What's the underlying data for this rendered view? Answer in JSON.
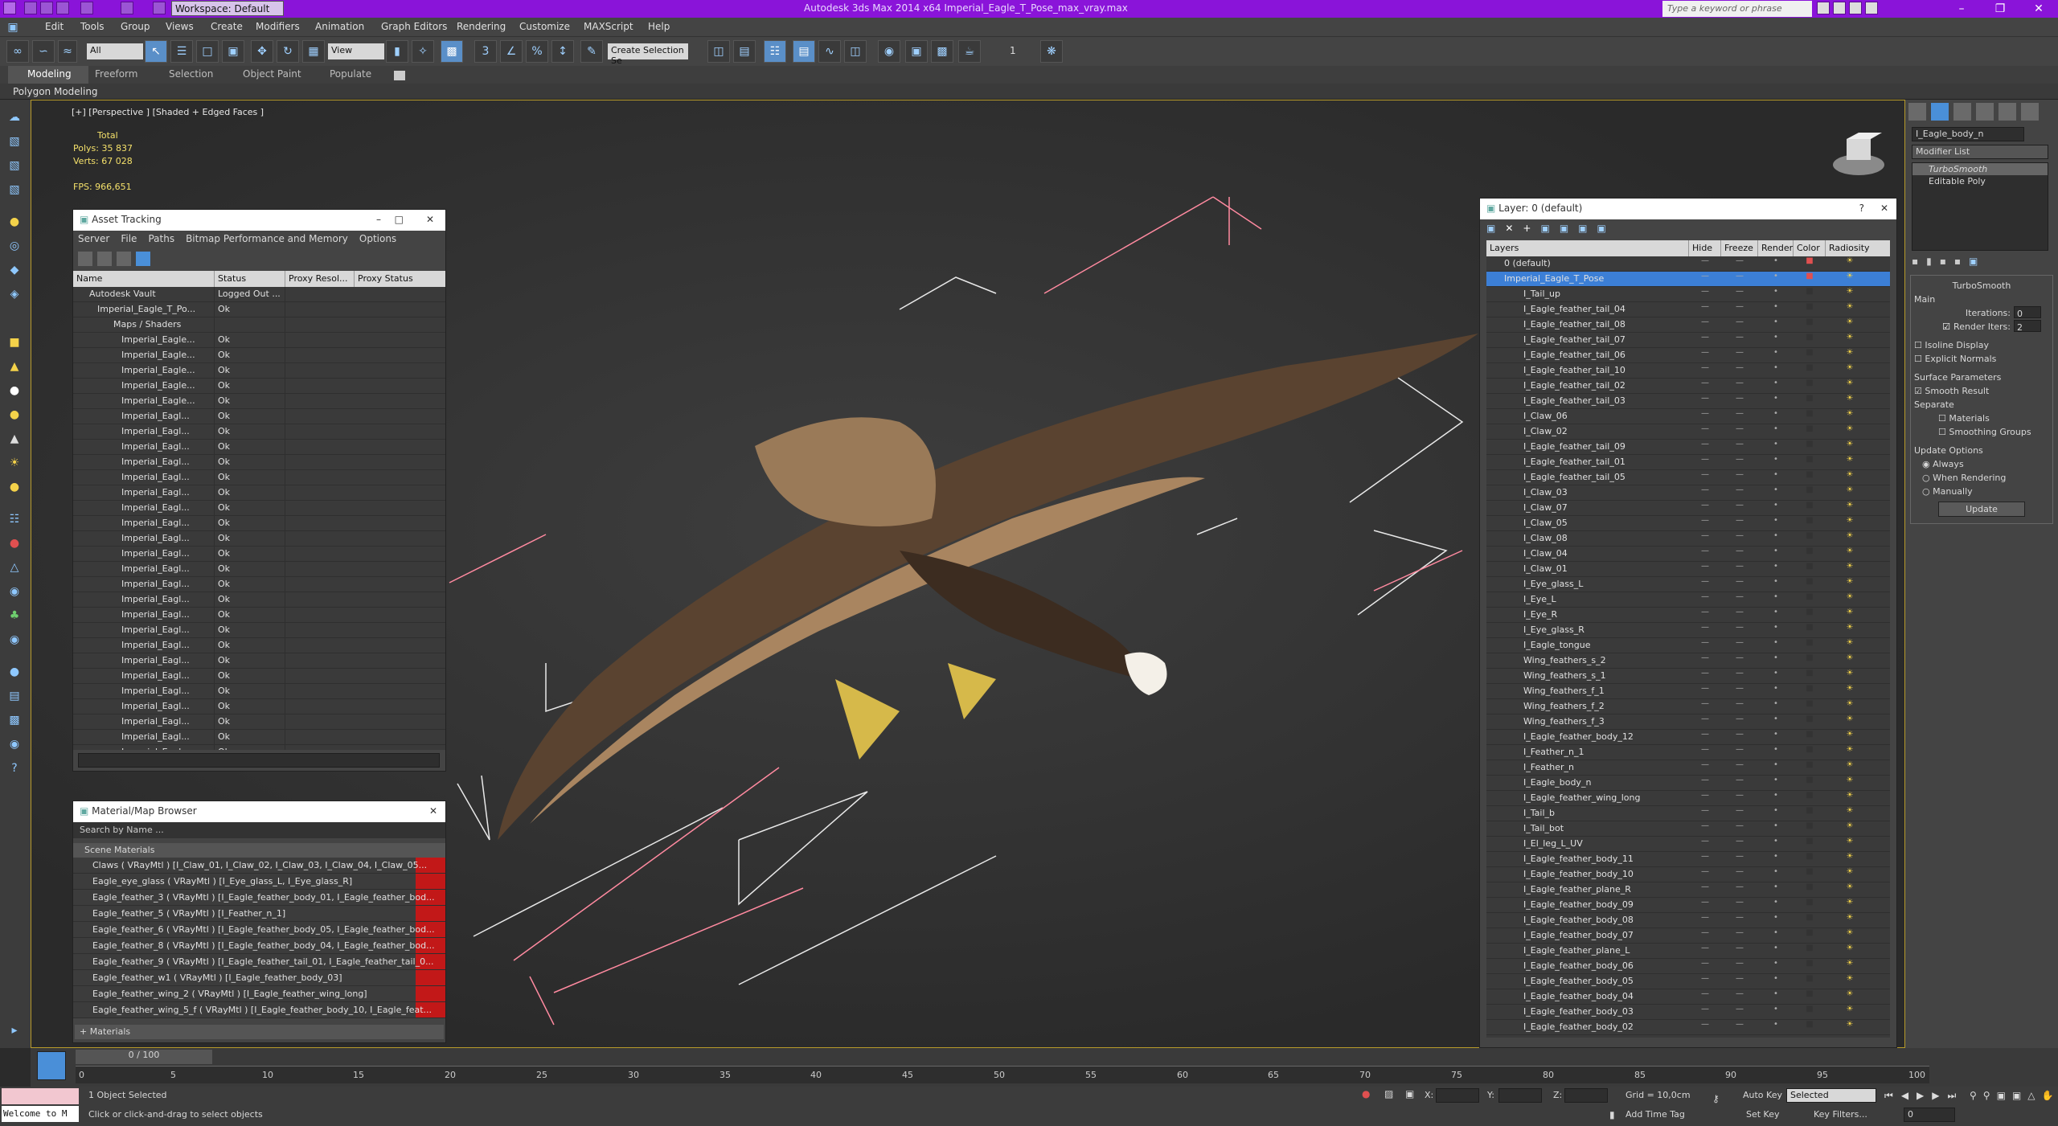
{
  "window": {
    "title": "Autodesk 3ds Max 2014 x64      Imperial_Eagle_T_Pose_max_vray.max",
    "workspace": "Workspace: Default",
    "search_placeholder": "Type a keyword or phrase"
  },
  "menu": [
    "Edit",
    "Tools",
    "Group",
    "Views",
    "Create",
    "Modifiers",
    "Animation",
    "Graph Editors",
    "Rendering",
    "Customize",
    "MAXScript",
    "Help"
  ],
  "toolbar": {
    "filter": "All",
    "refcoord": "View",
    "selset": "Create Selection Se",
    "num": "1"
  },
  "ribbon": {
    "tabs": [
      "Modeling",
      "Freeform",
      "Selection",
      "Object Paint",
      "Populate"
    ],
    "sub": "Polygon Modeling"
  },
  "viewport": {
    "label": "[+] [Perspective ] [Shaded + Edged Faces ]",
    "stats": {
      "total": "Total",
      "polys": "Polys:    35 837",
      "verts": "Verts:    67 028",
      "fps": "FPS:      966,651"
    }
  },
  "asset": {
    "title": "Asset Tracking",
    "menu": [
      "Server",
      "File",
      "Paths",
      "Bitmap Performance and Memory",
      "Options"
    ],
    "cols": [
      "Name",
      "Status",
      "Proxy Resol...",
      "Proxy Status"
    ],
    "rows": [
      [
        "Autodesk Vault",
        "Logged Out ..."
      ],
      [
        "Imperial_Eagle_T_Po...",
        "Ok"
      ],
      [
        "Maps / Shaders",
        ""
      ],
      [
        "Imperial_Eagle...",
        "Ok"
      ],
      [
        "Imperial_Eagle...",
        "Ok"
      ],
      [
        "Imperial_Eagle...",
        "Ok"
      ],
      [
        "Imperial_Eagle...",
        "Ok"
      ],
      [
        "Imperial_Eagle...",
        "Ok"
      ],
      [
        "Imperial_Eagl...",
        "Ok"
      ],
      [
        "Imperial_Eagl...",
        "Ok"
      ],
      [
        "Imperial_Eagl...",
        "Ok"
      ],
      [
        "Imperial_Eagl...",
        "Ok"
      ],
      [
        "Imperial_Eagl...",
        "Ok"
      ],
      [
        "Imperial_Eagl...",
        "Ok"
      ],
      [
        "Imperial_Eagl...",
        "Ok"
      ],
      [
        "Imperial_Eagl...",
        "Ok"
      ],
      [
        "Imperial_Eagl...",
        "Ok"
      ],
      [
        "Imperial_Eagl...",
        "Ok"
      ],
      [
        "Imperial_Eagl...",
        "Ok"
      ],
      [
        "Imperial_Eagl...",
        "Ok"
      ],
      [
        "Imperial_Eagl...",
        "Ok"
      ],
      [
        "Imperial_Eagl...",
        "Ok"
      ],
      [
        "Imperial_Eagl...",
        "Ok"
      ],
      [
        "Imperial_Eagl...",
        "Ok"
      ],
      [
        "Imperial_Eagl...",
        "Ok"
      ],
      [
        "Imperial_Eagl...",
        "Ok"
      ],
      [
        "Imperial_Eagl...",
        "Ok"
      ],
      [
        "Imperial_Eagl...",
        "Ok"
      ],
      [
        "Imperial_Eagl...",
        "Ok"
      ],
      [
        "Imperial_Eagl...",
        "Ok"
      ],
      [
        "Imperial_Eagl...",
        "Ok"
      ]
    ]
  },
  "matbrowser": {
    "title": "Material/Map Browser",
    "search": "Search by Name ...",
    "section": "Scene Materials",
    "footer": "+ Materials",
    "rows": [
      "Claws  ( VRayMtl ) [I_Claw_01, I_Claw_02, I_Claw_03, I_Claw_04, I_Claw_05...",
      "Eagle_eye_glass  ( VRayMtl ) [I_Eye_glass_L, I_Eye_glass_R]",
      "Eagle_feather_3  ( VRayMtl ) [I_Eagle_feather_body_01, I_Eagle_feather_bod...",
      "Eagle_feather_5  ( VRayMtl ) [I_Feather_n_1]",
      "Eagle_feather_6  ( VRayMtl ) [I_Eagle_feather_body_05, I_Eagle_feather_bod...",
      "Eagle_feather_8  ( VRayMtl ) [I_Eagle_feather_body_04, I_Eagle_feather_bod...",
      "Eagle_feather_9  ( VRayMtl ) [I_Eagle_feather_tail_01, I_Eagle_feather_tail_0...",
      "Eagle_feather_w1  ( VRayMtl ) [I_Eagle_feather_body_03]",
      "Eagle_feather_wing_2  ( VRayMtl ) [I_Eagle_feather_wing_long]",
      "Eagle_feather_wing_5_f  ( VRayMtl ) [I_Eagle_feather_body_10, I_Eagle_feat..."
    ]
  },
  "layer": {
    "title": "Layer: 0 (default)",
    "cols": [
      "Layers",
      "Hide",
      "Freeze",
      "Render",
      "Color",
      "Radiosity"
    ],
    "rows": [
      "0 (default)",
      "Imperial_Eagle_T_Pose",
      "I_Tail_up",
      "I_Eagle_feather_tail_04",
      "I_Eagle_feather_tail_08",
      "I_Eagle_feather_tail_07",
      "I_Eagle_feather_tail_06",
      "I_Eagle_feather_tail_10",
      "I_Eagle_feather_tail_02",
      "I_Eagle_feather_tail_03",
      "I_Claw_06",
      "I_Claw_02",
      "I_Eagle_feather_tail_09",
      "I_Eagle_feather_tail_01",
      "I_Eagle_feather_tail_05",
      "I_Claw_03",
      "I_Claw_07",
      "I_Claw_05",
      "I_Claw_08",
      "I_Claw_04",
      "I_Claw_01",
      "I_Eye_glass_L",
      "I_Eye_L",
      "I_Eye_R",
      "I_Eye_glass_R",
      "I_Eagle_tongue",
      "Wing_feathers_s_2",
      "Wing_feathers_s_1",
      "Wing_feathers_f_1",
      "Wing_feathers_f_2",
      "Wing_feathers_f_3",
      "I_Eagle_feather_body_12",
      "I_Feather_n_1",
      "I_Feather_n",
      "I_Eagle_body_n",
      "I_Eagle_feather_wing_long",
      "I_Tail_b",
      "I_Tail_bot",
      "I_El_leg_L_UV",
      "I_Eagle_feather_body_11",
      "I_Eagle_feather_body_10",
      "I_Eagle_feather_plane_R",
      "I_Eagle_feather_body_09",
      "I_Eagle_feather_body_08",
      "I_Eagle_feather_body_07",
      "I_Eagle_feather_plane_L",
      "I_Eagle_feather_body_06",
      "I_Eagle_feather_body_05",
      "I_Eagle_feather_body_04",
      "I_Eagle_feather_body_03",
      "I_Eagle_feather_body_02"
    ]
  },
  "cmd": {
    "objname": "I_Eagle_body_n",
    "modlist": "Modifier List",
    "stack": [
      "TurboSmooth",
      "Editable Poly"
    ],
    "rollout": "TurboSmooth",
    "main": "Main",
    "iter_label": "Iterations:",
    "iter_val": "0",
    "render_label": "Render Iters:",
    "render_val": "2",
    "isoline": "Isoline Display",
    "explicit": "Explicit Normals",
    "surface": "Surface Parameters",
    "smooth": "Smooth Result",
    "separate": "Separate",
    "materials": "Materials",
    "smoothgroups": "Smoothing Groups",
    "update_opts": "Update Options",
    "always": "Always",
    "whenrender": "When Rendering",
    "manually": "Manually",
    "update_btn": "Update"
  },
  "timeline": {
    "frame": "0 / 100",
    "ticks": [
      "0",
      "5",
      "10",
      "15",
      "20",
      "25",
      "30",
      "35",
      "40",
      "45",
      "50",
      "55",
      "60",
      "65",
      "70",
      "75",
      "80",
      "85",
      "90",
      "95",
      "100"
    ]
  },
  "status": {
    "welcome": "Welcome to M",
    "selected": "1 Object Selected",
    "hint": "Click or click-and-drag to select objects",
    "x": "X:",
    "y": "Y:",
    "z": "Z:",
    "grid": "Grid = 10,0cm",
    "addtag": "Add Time Tag",
    "autokey": "Auto Key",
    "setkey": "Set Key",
    "selmode": "Selected",
    "keyfilters": "Key Filters...",
    "frame": "0"
  }
}
